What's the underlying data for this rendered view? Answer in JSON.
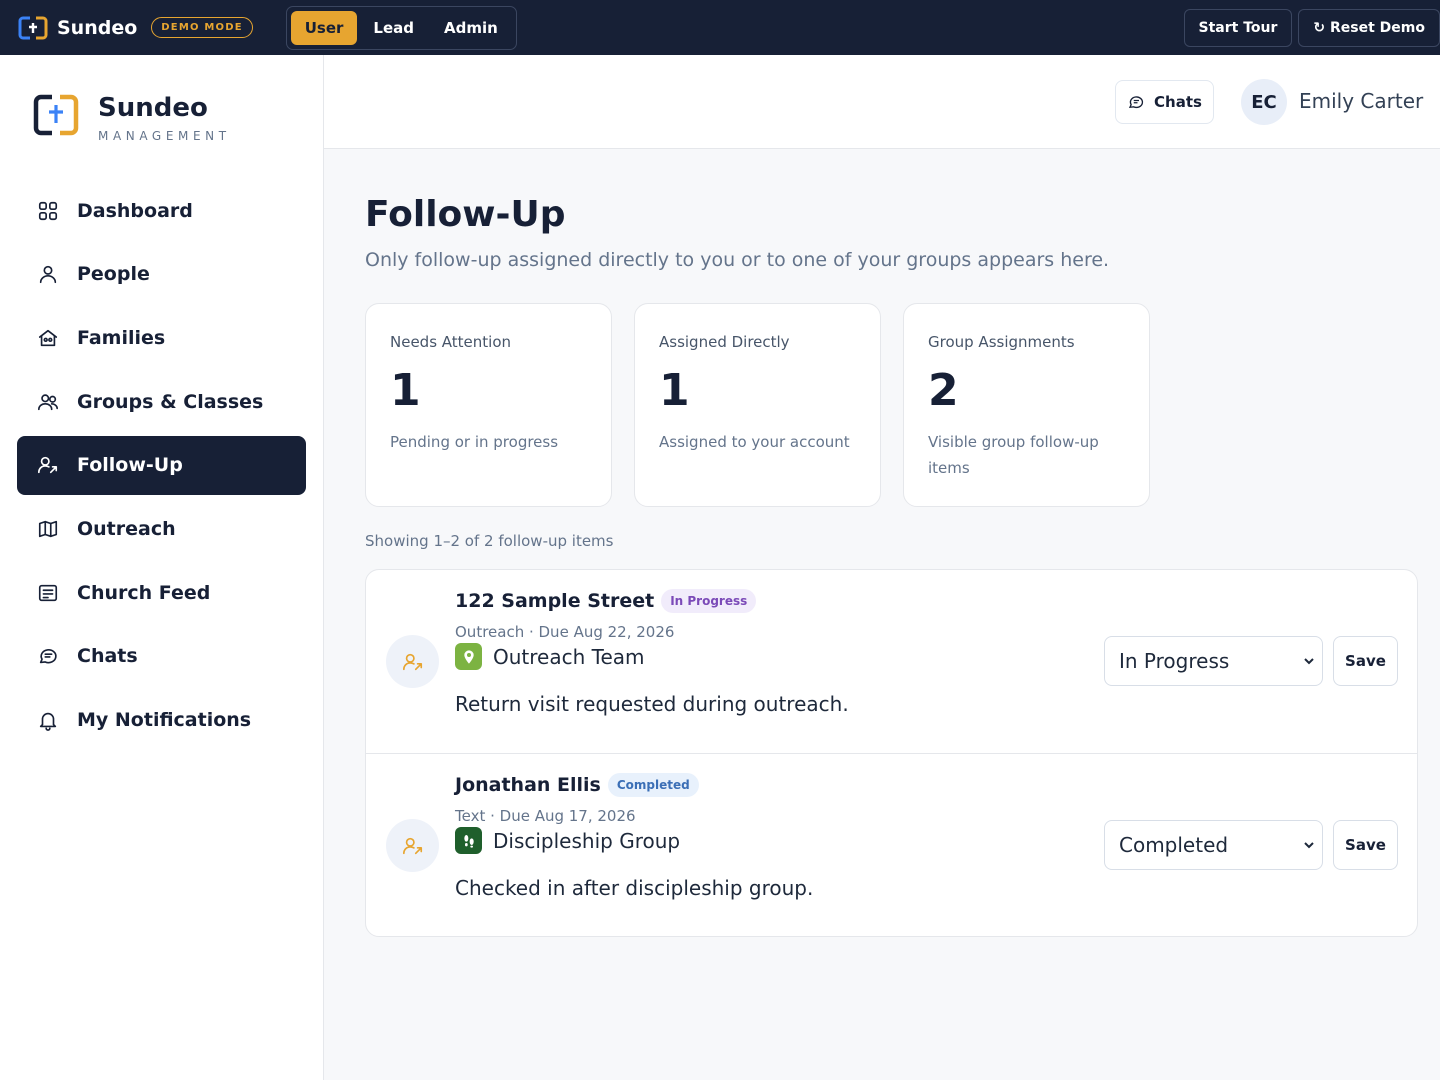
{
  "demobar": {
    "app_name": "Sundeo",
    "badge": "DEMO MODE",
    "roles": [
      "User",
      "Lead",
      "Admin"
    ],
    "active_role": "User",
    "start_tour": "Start Tour",
    "reset_demo": "↻ Reset Demo"
  },
  "sidebar": {
    "brand": "Sundeo",
    "brand_sub": "MANAGEMENT",
    "items": [
      {
        "label": "Dashboard",
        "icon": "grid-icon"
      },
      {
        "label": "People",
        "icon": "person-icon"
      },
      {
        "label": "Families",
        "icon": "home-icon"
      },
      {
        "label": "Groups & Classes",
        "icon": "users-icon"
      },
      {
        "label": "Follow-Up",
        "icon": "follow-up-icon",
        "active": true
      },
      {
        "label": "Outreach",
        "icon": "map-icon"
      },
      {
        "label": "Church Feed",
        "icon": "feed-icon"
      },
      {
        "label": "Chats",
        "icon": "chat-icon"
      },
      {
        "label": "My Notifications",
        "icon": "bell-icon"
      }
    ]
  },
  "header": {
    "chats_label": "Chats",
    "avatar_initials": "EC",
    "user_name": "Emily Carter"
  },
  "main": {
    "title": "Follow-Up",
    "subtitle": "Only follow-up assigned directly to you or to one of your groups appears here.",
    "stats": [
      {
        "label": "Needs Attention",
        "value": "1",
        "desc": "Pending or in progress"
      },
      {
        "label": "Assigned Directly",
        "value": "1",
        "desc": "Assigned to your account"
      },
      {
        "label": "Group Assignments",
        "value": "2",
        "desc": "Visible group follow-up items"
      }
    ],
    "showing": "Showing 1–2 of 2 follow-up items",
    "items": [
      {
        "name": "122 Sample Street",
        "status_badge": "In Progress",
        "meta": "Outreach · Due Aug 22, 2026",
        "group": "Outreach Team",
        "group_color": "#7cb342",
        "note": "Return visit requested during outreach.",
        "select_value": "In Progress",
        "save": "Save"
      },
      {
        "name": "Jonathan Ellis",
        "status_badge": "Completed",
        "meta": "Text · Due Aug 17, 2026",
        "group": "Discipleship Group",
        "group_color": "#1f5f2c",
        "note": "Checked in after discipleship group.",
        "select_value": "Completed",
        "save": "Save"
      }
    ]
  },
  "colors": {
    "navy": "#172036",
    "accent": "#e7a530"
  }
}
